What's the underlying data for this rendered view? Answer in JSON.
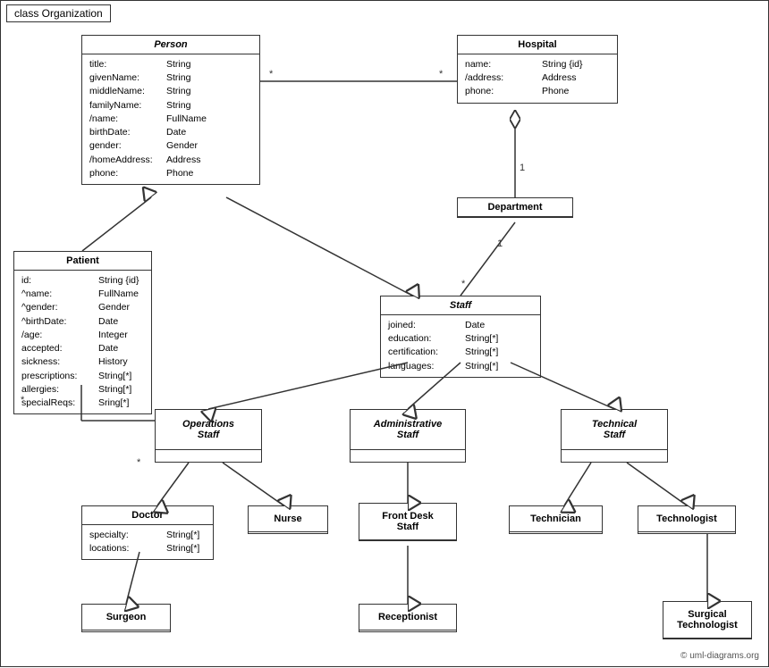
{
  "diagram": {
    "title": "class Organization",
    "copyright": "© uml-diagrams.org",
    "classes": {
      "person": {
        "name": "Person",
        "italic": true,
        "attrs": [
          {
            "name": "title:",
            "type": "String"
          },
          {
            "name": "givenName:",
            "type": "String"
          },
          {
            "name": "middleName:",
            "type": "String"
          },
          {
            "name": "familyName:",
            "type": "String"
          },
          {
            "name": "/name:",
            "type": "FullName"
          },
          {
            "name": "birthDate:",
            "type": "Date"
          },
          {
            "name": "gender:",
            "type": "Gender"
          },
          {
            "name": "/homeAddress:",
            "type": "Address"
          },
          {
            "name": "phone:",
            "type": "Phone"
          }
        ]
      },
      "hospital": {
        "name": "Hospital",
        "italic": false,
        "attrs": [
          {
            "name": "name:",
            "type": "String {id}"
          },
          {
            "name": "/address:",
            "type": "Address"
          },
          {
            "name": "phone:",
            "type": "Phone"
          }
        ]
      },
      "department": {
        "name": "Department",
        "italic": false,
        "attrs": []
      },
      "staff": {
        "name": "Staff",
        "italic": true,
        "attrs": [
          {
            "name": "joined:",
            "type": "Date"
          },
          {
            "name": "education:",
            "type": "String[*]"
          },
          {
            "name": "certification:",
            "type": "String[*]"
          },
          {
            "name": "languages:",
            "type": "String[*]"
          }
        ]
      },
      "patient": {
        "name": "Patient",
        "italic": false,
        "attrs": [
          {
            "name": "id:",
            "type": "String {id}"
          },
          {
            "name": "^name:",
            "type": "FullName"
          },
          {
            "name": "^gender:",
            "type": "Gender"
          },
          {
            "name": "^birthDate:",
            "type": "Date"
          },
          {
            "name": "/age:",
            "type": "Integer"
          },
          {
            "name": "accepted:",
            "type": "Date"
          },
          {
            "name": "sickness:",
            "type": "History"
          },
          {
            "name": "prescriptions:",
            "type": "String[*]"
          },
          {
            "name": "allergies:",
            "type": "String[*]"
          },
          {
            "name": "specialReqs:",
            "type": "Sring[*]"
          }
        ]
      },
      "operations_staff": {
        "name": "Operations Staff",
        "italic": true
      },
      "administrative_staff": {
        "name": "Administrative Staff",
        "italic": true
      },
      "technical_staff": {
        "name": "Technical Staff",
        "italic": true
      },
      "doctor": {
        "name": "Doctor",
        "attrs": [
          {
            "name": "specialty:",
            "type": "String[*]"
          },
          {
            "name": "locations:",
            "type": "String[*]"
          }
        ]
      },
      "nurse": {
        "name": "Nurse",
        "attrs": []
      },
      "front_desk_staff": {
        "name": "Front Desk Staff",
        "attrs": []
      },
      "technician": {
        "name": "Technician",
        "attrs": []
      },
      "technologist": {
        "name": "Technologist",
        "attrs": []
      },
      "surgeon": {
        "name": "Surgeon",
        "attrs": []
      },
      "receptionist": {
        "name": "Receptionist",
        "attrs": []
      },
      "surgical_technologist": {
        "name": "Surgical Technologist",
        "attrs": []
      }
    }
  }
}
